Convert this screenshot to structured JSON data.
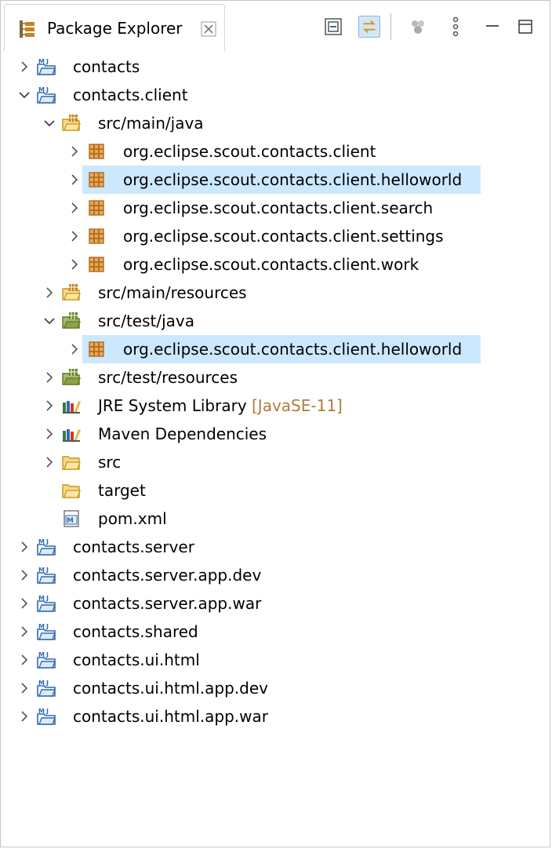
{
  "view": {
    "title": "Package Explorer",
    "toolbar": {
      "collapse_all": "collapse-all-icon",
      "link_with_editor": "link-with-editor-icon",
      "filters": "filters-icon",
      "view_menu": "view-menu-icon",
      "minimize": "minimize-icon",
      "maximize": "maximize-icon"
    }
  },
  "tree": [
    {
      "label": "contacts",
      "decoration": "",
      "depth": 0,
      "twisty": "collapsed",
      "icon": "maven-project-icon",
      "selected": false
    },
    {
      "label": "contacts.client",
      "decoration": "",
      "depth": 0,
      "twisty": "expanded",
      "icon": "maven-project-icon",
      "selected": false
    },
    {
      "label": "src/main/java",
      "decoration": "",
      "depth": 1,
      "twisty": "expanded",
      "icon": "source-folder-icon",
      "selected": false
    },
    {
      "label": "org.eclipse.scout.contacts.client",
      "decoration": "",
      "depth": 2,
      "twisty": "collapsed",
      "icon": "package-icon",
      "selected": false
    },
    {
      "label": "org.eclipse.scout.contacts.client.helloworld",
      "decoration": "",
      "depth": 2,
      "twisty": "collapsed",
      "icon": "package-icon",
      "selected": true
    },
    {
      "label": "org.eclipse.scout.contacts.client.search",
      "decoration": "",
      "depth": 2,
      "twisty": "collapsed",
      "icon": "package-icon",
      "selected": false
    },
    {
      "label": "org.eclipse.scout.contacts.client.settings",
      "decoration": "",
      "depth": 2,
      "twisty": "collapsed",
      "icon": "package-icon",
      "selected": false
    },
    {
      "label": "org.eclipse.scout.contacts.client.work",
      "decoration": "",
      "depth": 2,
      "twisty": "collapsed",
      "icon": "package-icon",
      "selected": false
    },
    {
      "label": "src/main/resources",
      "decoration": "",
      "depth": 1,
      "twisty": "collapsed",
      "icon": "source-folder-icon",
      "selected": false
    },
    {
      "label": "src/test/java",
      "decoration": "",
      "depth": 1,
      "twisty": "expanded",
      "icon": "test-source-folder-icon",
      "selected": false
    },
    {
      "label": "org.eclipse.scout.contacts.client.helloworld",
      "decoration": "",
      "depth": 2,
      "twisty": "collapsed",
      "icon": "package-icon",
      "selected": true
    },
    {
      "label": "src/test/resources",
      "decoration": "",
      "depth": 1,
      "twisty": "collapsed",
      "icon": "test-source-folder-icon",
      "selected": false
    },
    {
      "label": "JRE System Library",
      "decoration": "[JavaSE-11]",
      "depth": 1,
      "twisty": "collapsed",
      "icon": "library-icon",
      "selected": false
    },
    {
      "label": "Maven Dependencies",
      "decoration": "",
      "depth": 1,
      "twisty": "collapsed",
      "icon": "library-icon",
      "selected": false
    },
    {
      "label": "src",
      "decoration": "",
      "depth": 1,
      "twisty": "collapsed",
      "icon": "folder-icon",
      "selected": false
    },
    {
      "label": "target",
      "decoration": "",
      "depth": 1,
      "twisty": "none",
      "icon": "folder-icon",
      "selected": false
    },
    {
      "label": "pom.xml",
      "decoration": "",
      "depth": 1,
      "twisty": "none",
      "icon": "pom-file-icon",
      "selected": false
    },
    {
      "label": "contacts.server",
      "decoration": "",
      "depth": 0,
      "twisty": "collapsed",
      "icon": "maven-project-icon",
      "selected": false
    },
    {
      "label": "contacts.server.app.dev",
      "decoration": "",
      "depth": 0,
      "twisty": "collapsed",
      "icon": "maven-project-icon",
      "selected": false
    },
    {
      "label": "contacts.server.app.war",
      "decoration": "",
      "depth": 0,
      "twisty": "collapsed",
      "icon": "maven-project-icon",
      "selected": false
    },
    {
      "label": "contacts.shared",
      "decoration": "",
      "depth": 0,
      "twisty": "collapsed",
      "icon": "maven-project-icon",
      "selected": false
    },
    {
      "label": "contacts.ui.html",
      "decoration": "",
      "depth": 0,
      "twisty": "collapsed",
      "icon": "maven-project-icon",
      "selected": false
    },
    {
      "label": "contacts.ui.html.app.dev",
      "decoration": "",
      "depth": 0,
      "twisty": "collapsed",
      "icon": "maven-project-icon",
      "selected": false
    },
    {
      "label": "contacts.ui.html.app.war",
      "decoration": "",
      "depth": 0,
      "twisty": "collapsed",
      "icon": "maven-project-icon",
      "selected": false
    }
  ],
  "colors": {
    "selection": "#cce8ff",
    "decoration": "#b07c3a",
    "folder": "#e8b84a",
    "package": "#c8821e",
    "maven_blue": "#2f6ab0",
    "test_green": "#6a8a2a"
  }
}
